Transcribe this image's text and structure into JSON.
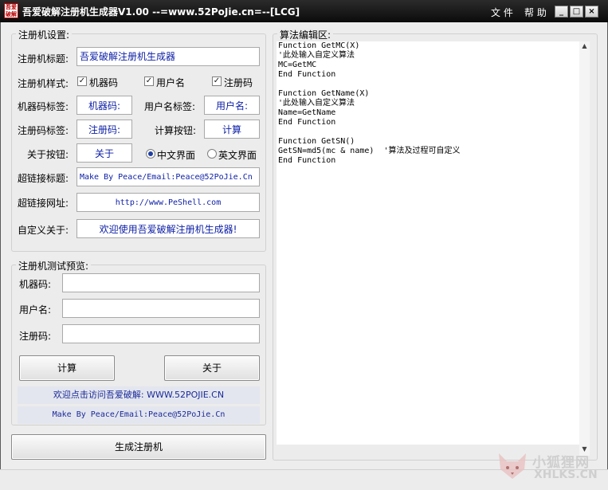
{
  "window": {
    "title": "吾爱破解注册机生成器V1.00  --=www.52PoJie.cn=--[LCG]",
    "logo_text": "吾爱破解",
    "menu": [
      "文 件",
      "帮 助"
    ],
    "buttons": {
      "minimize": "_",
      "maximize": "□",
      "close": "×"
    }
  },
  "settings": {
    "group_title": "注册机设置:",
    "title_label": "注册机标题:",
    "title_value": "吾爱破解注册机生成器",
    "style_label": "注册机样式:",
    "style_options": [
      {
        "label": "机器码",
        "checked": true
      },
      {
        "label": "用户名",
        "checked": true
      },
      {
        "label": "注册码",
        "checked": true
      }
    ],
    "mc_label_label": "机器码标签:",
    "mc_label_value": "机器码:",
    "user_label_label": "用户名标签:",
    "user_label_value": "用户名:",
    "sn_label_label": "注册码标签:",
    "sn_label_value": "注册码:",
    "calc_button_label": "计算按钮:",
    "calc_button_value": "计算",
    "about_button_label": "关于按钮:",
    "about_button_value": "关于",
    "interface": [
      {
        "label": "中文界面",
        "selected": true
      },
      {
        "label": "英文界面",
        "selected": false
      }
    ],
    "link_title_label": "超链接标题:",
    "link_title_value": "Make By Peace/Email:Peace@52PoJie.Cn",
    "link_url_label": "超链接网址:",
    "link_url_value": "http://www.PeShell.com",
    "about_label": "自定义关于:",
    "about_value": "欢迎使用吾爱破解注册机生成器!"
  },
  "preview": {
    "group_title": "注册机测试预览:",
    "mc_label": "机器码:",
    "user_label": "用户名:",
    "sn_label": "注册码:",
    "mc_value": "",
    "user_value": "",
    "sn_value": "",
    "calc_button": "计算",
    "about_button": "关于",
    "link1": "欢迎点击访问吾爱破解: WWW.52POJIE.CN",
    "link2": "Make By Peace/Email:Peace@52PoJie.Cn"
  },
  "generate_button": "生成注册机",
  "editor": {
    "group_title": "算法编辑区:",
    "code": "Function GetMC(X)\n'此处输入自定义算法\nMC=GetMC\nEnd Function\n\nFunction GetName(X)\n'此处输入自定义算法\nName=GetName\nEnd Function\n\nFunction GetSN()\nGetSN=md5(mc & name)  '算法及过程可自定义\nEnd Function"
  },
  "watermark": {
    "text": "小狐狸网",
    "url": "XHLKS.CN"
  }
}
